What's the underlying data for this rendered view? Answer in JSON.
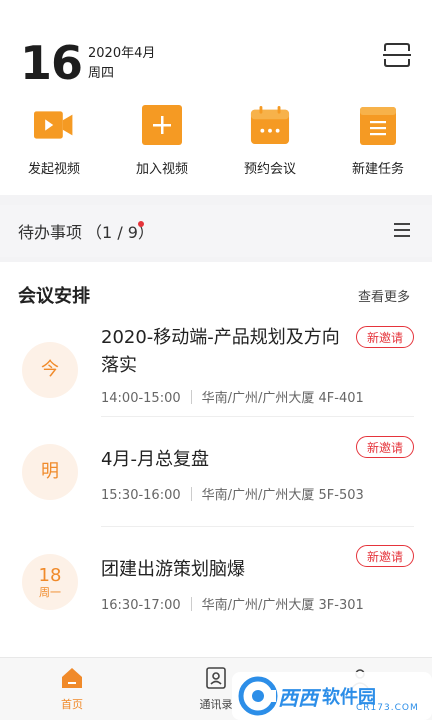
{
  "header": {
    "day": "16",
    "month_year": "2020年4月",
    "weekday": "周四",
    "scan_icon": "scan-icon"
  },
  "quick_actions": [
    {
      "label": "发起视频",
      "icon": "video-camera-icon"
    },
    {
      "label": "加入视频",
      "icon": "plus-icon"
    },
    {
      "label": "预约会议",
      "icon": "calendar-icon"
    },
    {
      "label": "新建任务",
      "icon": "task-list-icon"
    }
  ],
  "todo": {
    "title": "待办事项",
    "count_open": "（",
    "done": "1",
    "slash": "/",
    "total": "9",
    "count_close": "）"
  },
  "meetings": {
    "title": "会议安排",
    "more": "查看更多",
    "items": [
      {
        "day_main": "今",
        "day_sub": "",
        "title": "2020-移动端-产品规划及方向落实",
        "time": "14:00-15:00",
        "location": "华南/广州/广州大厦 4F-401",
        "badge": "新邀请"
      },
      {
        "day_main": "明",
        "day_sub": "",
        "title": "4月-月总复盘",
        "time": "15:30-16:00",
        "location": "华南/广州/广州大厦 5F-503",
        "badge": "新邀请"
      },
      {
        "day_main": "18",
        "day_sub": "周一",
        "title": "团建出游策划脑爆",
        "time": "16:30-17:00",
        "location": "华南/广州/广州大厦 3F-301",
        "badge": "新邀请"
      }
    ]
  },
  "tabs": [
    {
      "label": "首页",
      "icon": "home-icon",
      "active": true
    },
    {
      "label": "通讯录",
      "icon": "contacts-icon",
      "active": false
    },
    {
      "label": "",
      "icon": "profile-icon",
      "active": false
    }
  ],
  "watermark": {
    "brand": "西西",
    "suffix": "软件园",
    "url": "CR173.COM"
  },
  "colors": {
    "accent": "#f08a2a",
    "icon_orange": "#f59a23",
    "badge_red": "#e5343b",
    "section_bg": "#f5f5f7",
    "brand_blue": "#2c8ee8"
  }
}
